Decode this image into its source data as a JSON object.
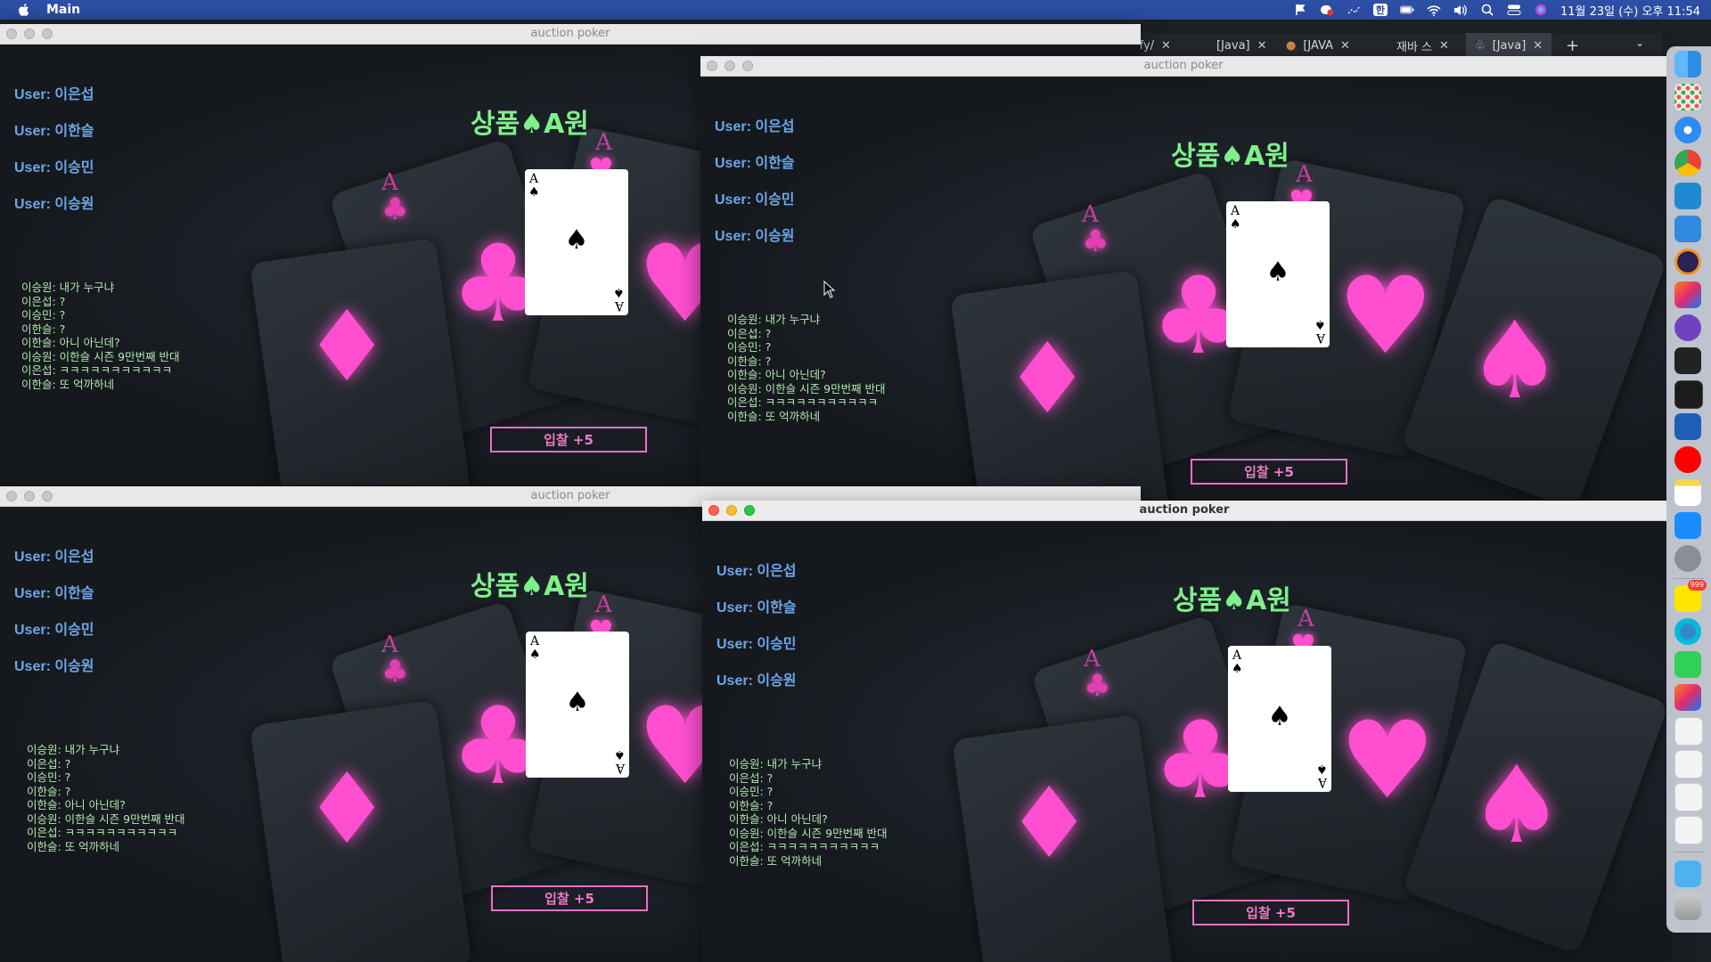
{
  "menubar": {
    "app_name": "Main",
    "clock": "11월 23일 (수) 오후 11:54",
    "status_icons": [
      "flag-icon",
      "record-icon",
      "dots-icon",
      "input-icon",
      "battery-icon",
      "wifi-icon",
      "volume-icon",
      "search-icon",
      "control-center-icon",
      "siri-icon"
    ],
    "input_label": "한"
  },
  "browser_tabs": {
    "tabs": [
      {
        "label": "ify/"
      },
      {
        "label": "[Java]"
      },
      {
        "label": "[JAVA"
      },
      {
        "label": "재바 스"
      },
      {
        "label": "[Java]"
      }
    ],
    "close_glyph": "✕",
    "plus_glyph": "+",
    "chevron_glyph": "⌄"
  },
  "game": {
    "window_title": "auction poker",
    "users": [
      {
        "label": "User: 이은섭"
      },
      {
        "label": "User: 이한슬"
      },
      {
        "label": "User: 이승민"
      },
      {
        "label": "User: 이승원"
      }
    ],
    "item_title": "상품♠A원",
    "card": {
      "rank": "A",
      "suit": "♠"
    },
    "chat": [
      "이승원: 내가 누구냐",
      "이은섭: ?",
      "이승민: ?",
      "이한슬: ?",
      "이한슬: 아니 아닌데?",
      "이승원: 이한슬 시즌 9만번째 반대",
      "이은섭: ㅋㅋㅋㅋㅋㅋㅋㅋㅋㅋㅋ",
      "이한슬: 또 억까하네"
    ],
    "bid_button": "입찰 +5",
    "bg_letter": "A"
  },
  "colors": {
    "user_text": "#6ea6e8",
    "title_text": "#7ef08a",
    "chat_text": "#b4e6b0",
    "neon_pink": "#ff4fd0",
    "button_border": "#e870c8"
  },
  "dock": {
    "apps": [
      "finder-icon",
      "launchpad-icon",
      "safari-icon",
      "chrome-icon",
      "vscode-icon",
      "xcode-icon",
      "eclipse-icon",
      "intellij-icon",
      "github-desktop-icon",
      "terminal-icon",
      "activity-monitor-icon",
      "sourcetree-icon",
      "youtube-music-icon",
      "notes-icon",
      "app-store-icon",
      "system-preferences-icon",
      "kakaotalk-icon",
      "webex-icon",
      "facetime-icon",
      "intellij-icon-2",
      "java-icon-1",
      "java-icon-2",
      "java-icon-3",
      "java-icon-4",
      "folder-icon",
      "trash-icon"
    ],
    "kakao_badge": "999"
  }
}
